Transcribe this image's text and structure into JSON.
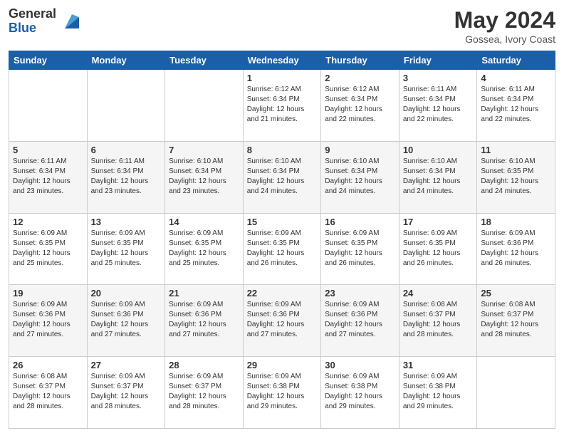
{
  "header": {
    "logo_general": "General",
    "logo_blue": "Blue",
    "month_title": "May 2024",
    "location": "Gossea, Ivory Coast"
  },
  "days_of_week": [
    "Sunday",
    "Monday",
    "Tuesday",
    "Wednesday",
    "Thursday",
    "Friday",
    "Saturday"
  ],
  "weeks": [
    [
      {
        "day": "",
        "info": ""
      },
      {
        "day": "",
        "info": ""
      },
      {
        "day": "",
        "info": ""
      },
      {
        "day": "1",
        "info": "Sunrise: 6:12 AM\nSunset: 6:34 PM\nDaylight: 12 hours\nand 21 minutes."
      },
      {
        "day": "2",
        "info": "Sunrise: 6:12 AM\nSunset: 6:34 PM\nDaylight: 12 hours\nand 22 minutes."
      },
      {
        "day": "3",
        "info": "Sunrise: 6:11 AM\nSunset: 6:34 PM\nDaylight: 12 hours\nand 22 minutes."
      },
      {
        "day": "4",
        "info": "Sunrise: 6:11 AM\nSunset: 6:34 PM\nDaylight: 12 hours\nand 22 minutes."
      }
    ],
    [
      {
        "day": "5",
        "info": "Sunrise: 6:11 AM\nSunset: 6:34 PM\nDaylight: 12 hours\nand 23 minutes."
      },
      {
        "day": "6",
        "info": "Sunrise: 6:11 AM\nSunset: 6:34 PM\nDaylight: 12 hours\nand 23 minutes."
      },
      {
        "day": "7",
        "info": "Sunrise: 6:10 AM\nSunset: 6:34 PM\nDaylight: 12 hours\nand 23 minutes."
      },
      {
        "day": "8",
        "info": "Sunrise: 6:10 AM\nSunset: 6:34 PM\nDaylight: 12 hours\nand 24 minutes."
      },
      {
        "day": "9",
        "info": "Sunrise: 6:10 AM\nSunset: 6:34 PM\nDaylight: 12 hours\nand 24 minutes."
      },
      {
        "day": "10",
        "info": "Sunrise: 6:10 AM\nSunset: 6:34 PM\nDaylight: 12 hours\nand 24 minutes."
      },
      {
        "day": "11",
        "info": "Sunrise: 6:10 AM\nSunset: 6:35 PM\nDaylight: 12 hours\nand 24 minutes."
      }
    ],
    [
      {
        "day": "12",
        "info": "Sunrise: 6:09 AM\nSunset: 6:35 PM\nDaylight: 12 hours\nand 25 minutes."
      },
      {
        "day": "13",
        "info": "Sunrise: 6:09 AM\nSunset: 6:35 PM\nDaylight: 12 hours\nand 25 minutes."
      },
      {
        "day": "14",
        "info": "Sunrise: 6:09 AM\nSunset: 6:35 PM\nDaylight: 12 hours\nand 25 minutes."
      },
      {
        "day": "15",
        "info": "Sunrise: 6:09 AM\nSunset: 6:35 PM\nDaylight: 12 hours\nand 26 minutes."
      },
      {
        "day": "16",
        "info": "Sunrise: 6:09 AM\nSunset: 6:35 PM\nDaylight: 12 hours\nand 26 minutes."
      },
      {
        "day": "17",
        "info": "Sunrise: 6:09 AM\nSunset: 6:35 PM\nDaylight: 12 hours\nand 26 minutes."
      },
      {
        "day": "18",
        "info": "Sunrise: 6:09 AM\nSunset: 6:36 PM\nDaylight: 12 hours\nand 26 minutes."
      }
    ],
    [
      {
        "day": "19",
        "info": "Sunrise: 6:09 AM\nSunset: 6:36 PM\nDaylight: 12 hours\nand 27 minutes."
      },
      {
        "day": "20",
        "info": "Sunrise: 6:09 AM\nSunset: 6:36 PM\nDaylight: 12 hours\nand 27 minutes."
      },
      {
        "day": "21",
        "info": "Sunrise: 6:09 AM\nSunset: 6:36 PM\nDaylight: 12 hours\nand 27 minutes."
      },
      {
        "day": "22",
        "info": "Sunrise: 6:09 AM\nSunset: 6:36 PM\nDaylight: 12 hours\nand 27 minutes."
      },
      {
        "day": "23",
        "info": "Sunrise: 6:09 AM\nSunset: 6:36 PM\nDaylight: 12 hours\nand 27 minutes."
      },
      {
        "day": "24",
        "info": "Sunrise: 6:08 AM\nSunset: 6:37 PM\nDaylight: 12 hours\nand 28 minutes."
      },
      {
        "day": "25",
        "info": "Sunrise: 6:08 AM\nSunset: 6:37 PM\nDaylight: 12 hours\nand 28 minutes."
      }
    ],
    [
      {
        "day": "26",
        "info": "Sunrise: 6:08 AM\nSunset: 6:37 PM\nDaylight: 12 hours\nand 28 minutes."
      },
      {
        "day": "27",
        "info": "Sunrise: 6:09 AM\nSunset: 6:37 PM\nDaylight: 12 hours\nand 28 minutes."
      },
      {
        "day": "28",
        "info": "Sunrise: 6:09 AM\nSunset: 6:37 PM\nDaylight: 12 hours\nand 28 minutes."
      },
      {
        "day": "29",
        "info": "Sunrise: 6:09 AM\nSunset: 6:38 PM\nDaylight: 12 hours\nand 29 minutes."
      },
      {
        "day": "30",
        "info": "Sunrise: 6:09 AM\nSunset: 6:38 PM\nDaylight: 12 hours\nand 29 minutes."
      },
      {
        "day": "31",
        "info": "Sunrise: 6:09 AM\nSunset: 6:38 PM\nDaylight: 12 hours\nand 29 minutes."
      },
      {
        "day": "",
        "info": ""
      }
    ]
  ]
}
